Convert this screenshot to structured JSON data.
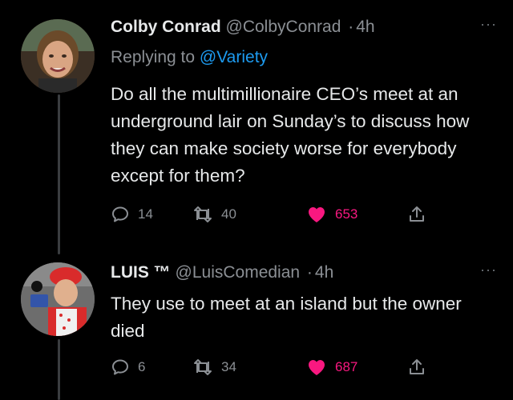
{
  "tweets": [
    {
      "display_name": "Colby Conrad",
      "handle": "@ColbyConrad",
      "separator": "·",
      "time": "4h",
      "reply_prefix": "Replying to",
      "reply_mention": "@Variety",
      "text": "Do all the multimillionaire CEO’s meet at an underground lair on Sunday’s to discuss how they can make society worse for everybody except for them?",
      "replies": "14",
      "retweets": "40",
      "likes": "653",
      "liked": true
    },
    {
      "display_name": "LUIS ™",
      "handle": "@LuisComedian",
      "separator": "·",
      "time": "4h",
      "text": "They use to meet at an island but the owner died",
      "replies": "6",
      "retweets": "34",
      "likes": "687",
      "liked": true
    }
  ],
  "more_label": "···",
  "colors": {
    "background": "#000000",
    "text": "#e7e9ea",
    "muted": "#8b8f94",
    "mention": "#1d9bf0",
    "like": "#f91880"
  }
}
